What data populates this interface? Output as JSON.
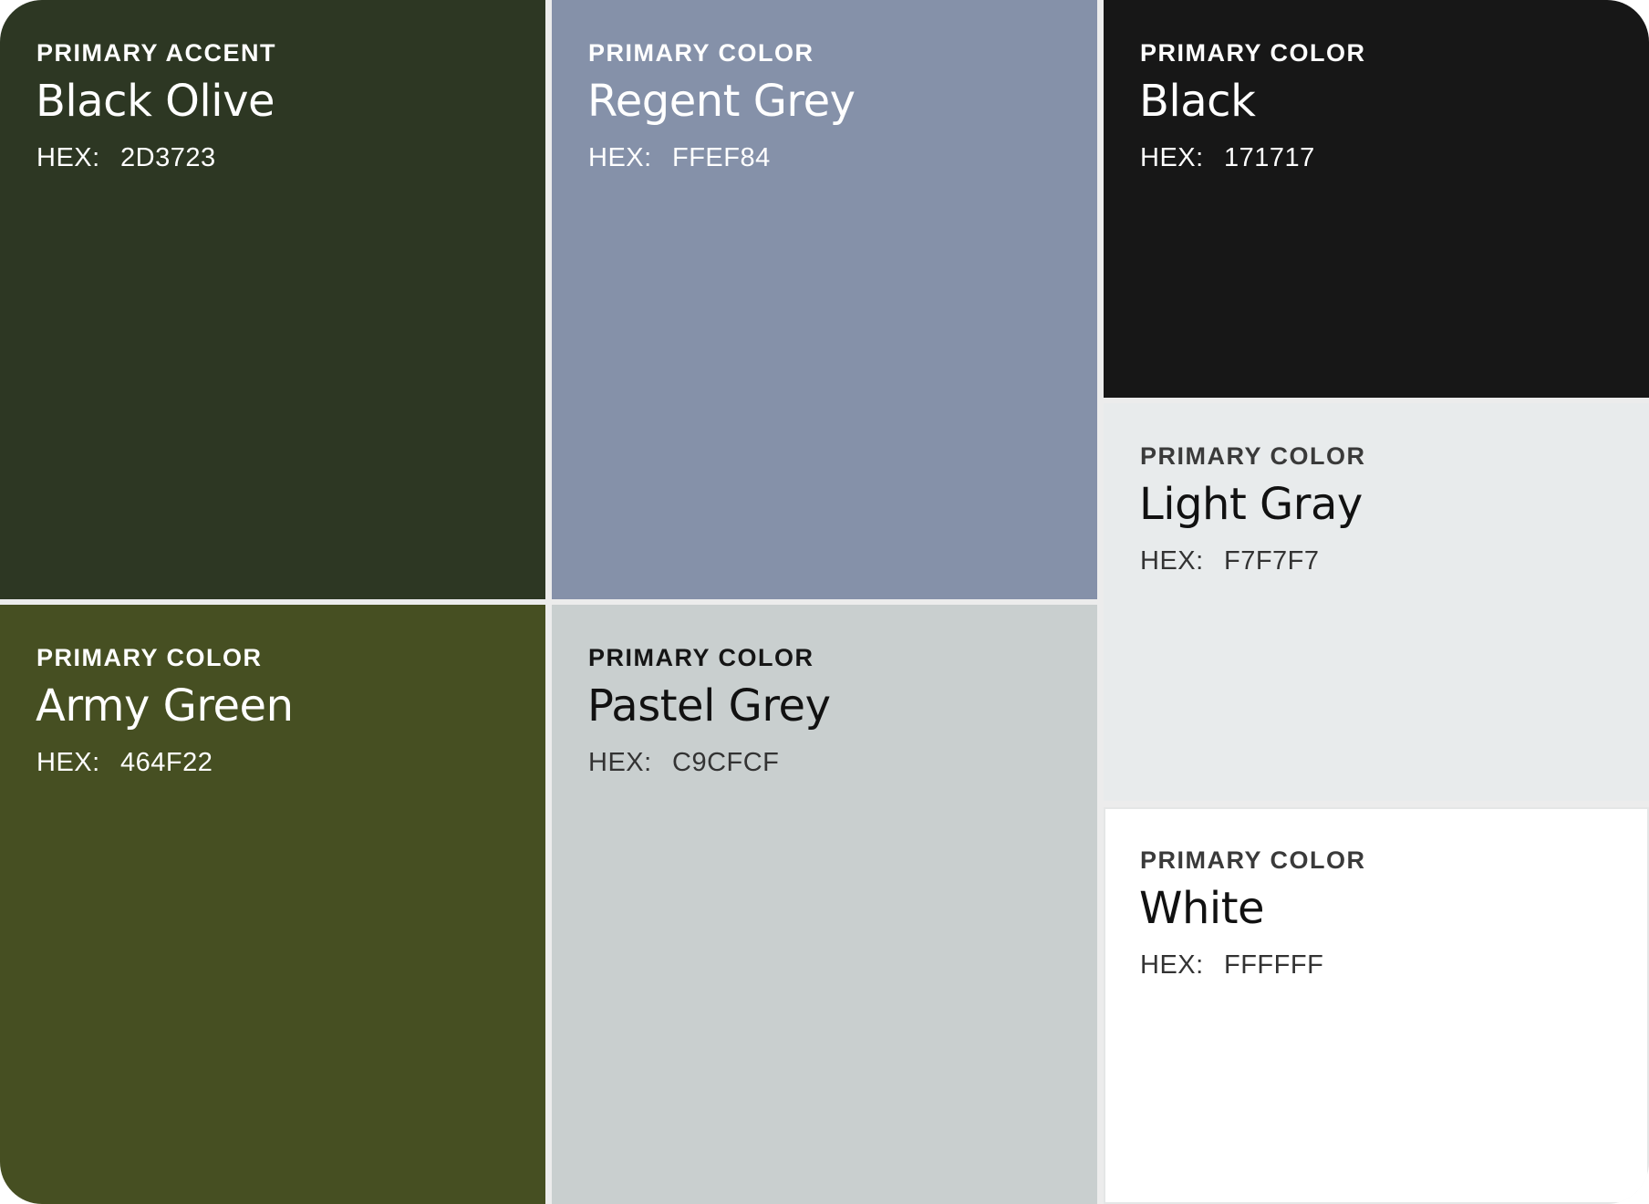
{
  "swatches": [
    {
      "id": "black-olive",
      "role": "PRIMARY ACCENT",
      "name": "Black Olive",
      "hex_label": "HEX:",
      "hex": "2D3723",
      "color": "#2D3723"
    },
    {
      "id": "regent-grey",
      "role": "PRIMARY COLOR",
      "name": "Regent Grey",
      "hex_label": "HEX:",
      "hex": "FFEF84",
      "color": "#8591A9"
    },
    {
      "id": "black",
      "role": "PRIMARY COLOR",
      "name": "Black",
      "hex_label": "HEX:",
      "hex": "171717",
      "color": "#171717"
    },
    {
      "id": "army-green",
      "role": "PRIMARY COLOR",
      "name": "Army Green",
      "hex_label": "HEX:",
      "hex": "464F22",
      "color": "#464F22"
    },
    {
      "id": "pastel-grey",
      "role": "PRIMARY COLOR",
      "name": "Pastel Grey",
      "hex_label": "HEX:",
      "hex": "C9CFCF",
      "color": "#C9CFCF"
    },
    {
      "id": "light-gray",
      "role": "PRIMARY COLOR",
      "name": "Light Gray",
      "hex_label": "HEX:",
      "hex": "F7F7F7",
      "color": "#E8EBEC"
    },
    {
      "id": "white",
      "role": "PRIMARY COLOR",
      "name": "White",
      "hex_label": "HEX:",
      "hex": "FFFFFF",
      "color": "#FFFFFF"
    }
  ]
}
